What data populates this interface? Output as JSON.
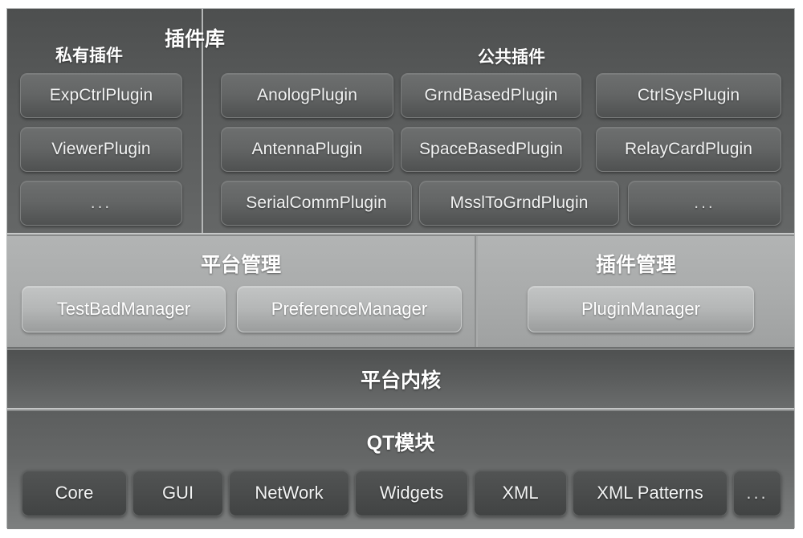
{
  "diagram": {
    "title": "插件库",
    "sections": {
      "plugin_library": {
        "title": "插件库",
        "private": {
          "title": "私有插件",
          "plugins": [
            "ExpCtrlPlugin",
            "ViewerPlugin",
            "..."
          ]
        },
        "public": {
          "title": "公共插件",
          "plugins": [
            "AnologPlugin",
            "GrndBasedPlugin",
            "CtrlSysPlugin",
            "AntennaPlugin",
            "SpaceBasedPlugin",
            "RelayCardPlugin",
            "SerialCommPlugin",
            "MsslToGrndPlugin",
            "..."
          ]
        }
      },
      "platform_management": {
        "title": "平台管理",
        "managers": [
          "TestBadManager",
          "PreferenceManager"
        ]
      },
      "plugin_management": {
        "title": "插件管理",
        "managers": [
          "PluginManager"
        ]
      },
      "platform_kernel": {
        "title": "平台内核"
      },
      "qt_module": {
        "title": "QT模块",
        "modules": [
          "Core",
          "GUI",
          "NetWork",
          "Widgets",
          "XML",
          "XML Patterns",
          "..."
        ]
      }
    }
  },
  "colors": {
    "page_background": "#ffffff",
    "frame_border": "#b9bbbb",
    "dark_band": "#585a5a",
    "light_band": "#a9abab",
    "kernel_band": "#5b5d5d",
    "qt_band": "#656767",
    "chip_text": "#f2f3f3",
    "title_text": "#ffffff"
  }
}
